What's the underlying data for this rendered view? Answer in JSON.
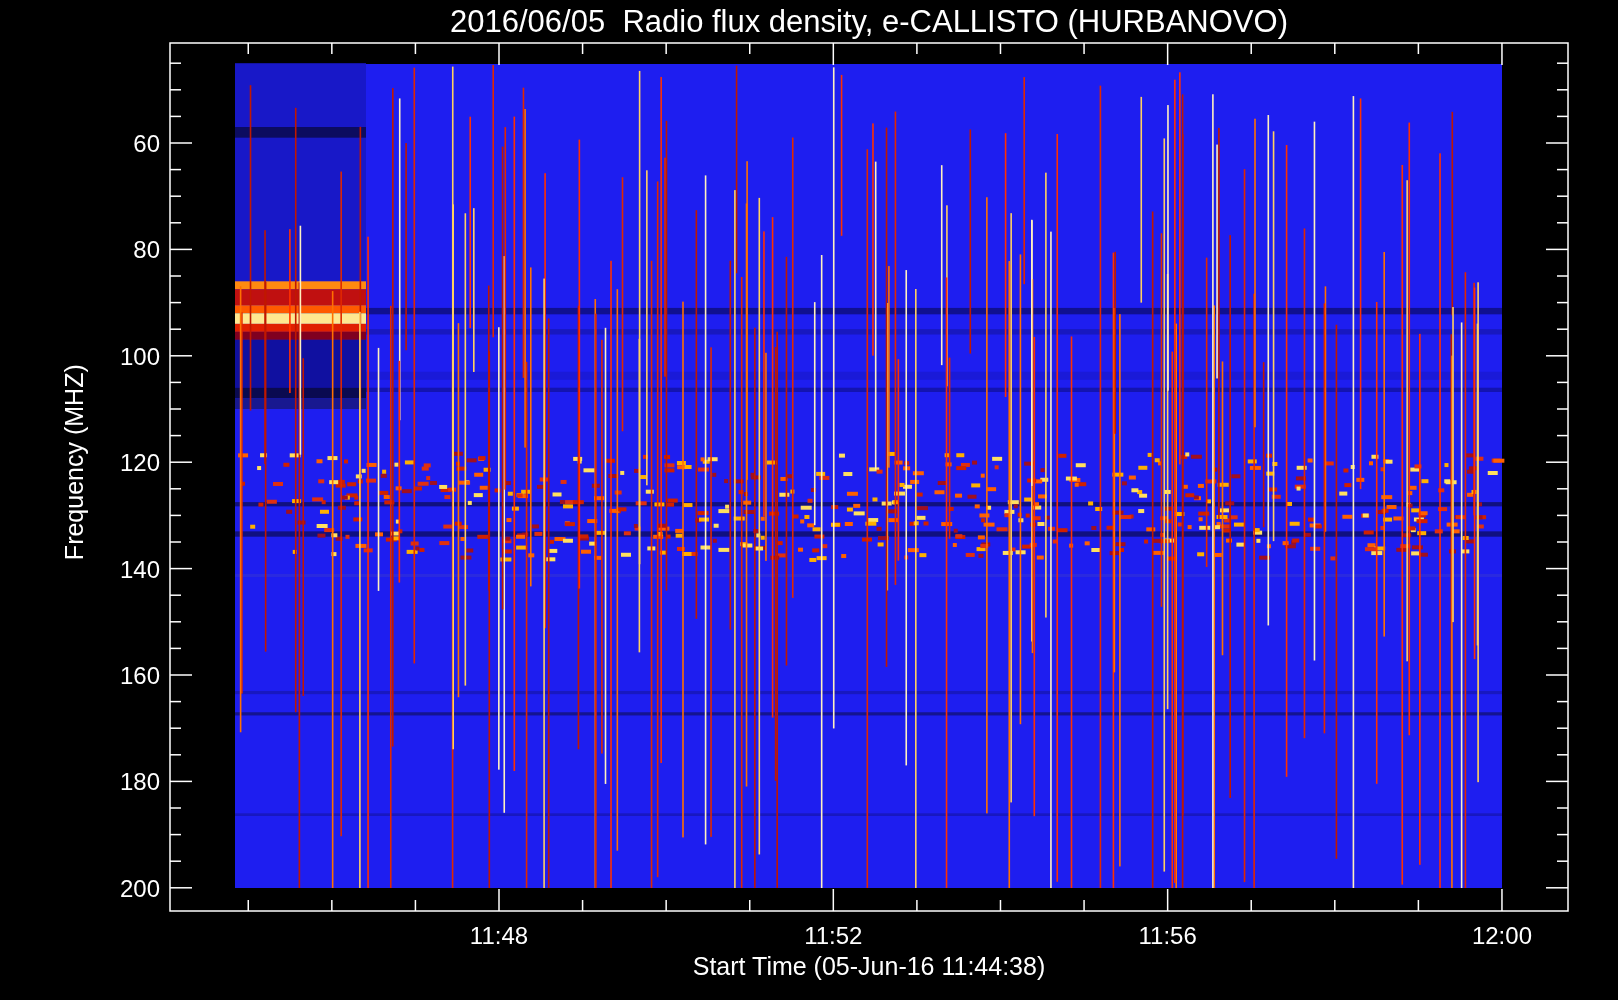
{
  "title": "2016/06/05  Radio flux density, e-CALLISTO (HURBANOVO)",
  "y_axis": {
    "label": "Frequency (MHZ)",
    "ticks": [
      "60",
      "80",
      "100",
      "120",
      "140",
      "160",
      "180",
      "200"
    ]
  },
  "x_axis": {
    "label": "Start Time (05-Jun-16 11:44:38)",
    "ticks": [
      "11:48",
      "11:52",
      "11:56",
      "12:00"
    ]
  }
}
